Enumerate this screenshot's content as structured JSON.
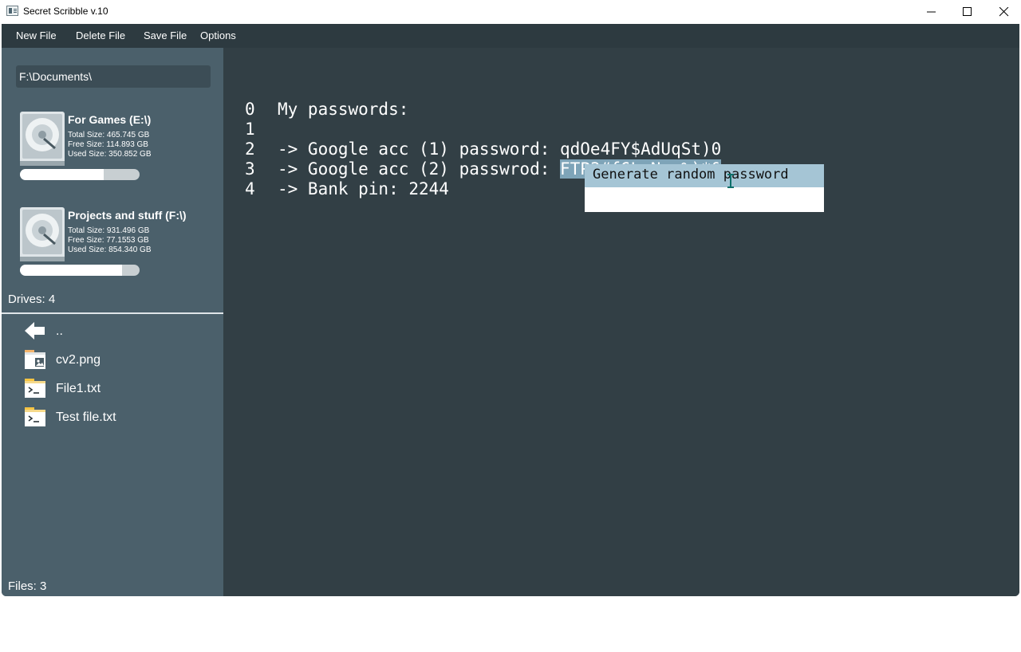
{
  "window": {
    "title": "Secret Scribble v.10",
    "controls": [
      "minimize-icon",
      "maximize-icon",
      "close-icon"
    ]
  },
  "menu": {
    "new_file": "New File",
    "delete_file": "Delete File",
    "save_file": "Save File",
    "options": "Options"
  },
  "sidebar": {
    "path": "F:\\Documents\\",
    "drives": [
      {
        "name": "For Games (E:\\)",
        "total": "Total Size: 465.745 GB",
        "free": "Free Size: 114.893 GB",
        "used": "Used Size: 350.852 GB",
        "used_fraction": 0.7
      },
      {
        "name": "Projects and stuff (F:\\)",
        "total": "Total Size: 931.496 GB",
        "free": "Free Size: 77.1553 GB",
        "used": "Used Size: 854.340 GB",
        "used_fraction": 0.85
      }
    ],
    "drives_count": "Drives: 4",
    "files": [
      {
        "name": "..",
        "icon": "back-arrow-icon"
      },
      {
        "name": "cv2.png",
        "icon": "image-file-icon"
      },
      {
        "name": "File1.txt",
        "icon": "text-file-icon"
      },
      {
        "name": "Test file.txt",
        "icon": "text-file-icon"
      }
    ],
    "files_count": "Files: 3"
  },
  "editor": {
    "lines": [
      {
        "num": "0",
        "text": "My passwords:"
      },
      {
        "num": "1",
        "text": ""
      },
      {
        "num": "2",
        "text": "-> Google acc (1) password: qdOe4FY$AdUqSt)0"
      },
      {
        "num": "3",
        "text": "-> Google acc (2) passwrod: ",
        "selected": "FTP3#f6LvNzs%)*&"
      },
      {
        "num": "4",
        "text": "-> Bank pin: 2244"
      }
    ],
    "context_menu": {
      "items": [
        "Generate random password"
      ]
    }
  },
  "colors": {
    "menubar": "#2d3a40",
    "sidebar": "#4b606b",
    "editor": "#323f45",
    "selection": "#7ea4b8",
    "context_highlight": "#a5c5d5"
  }
}
